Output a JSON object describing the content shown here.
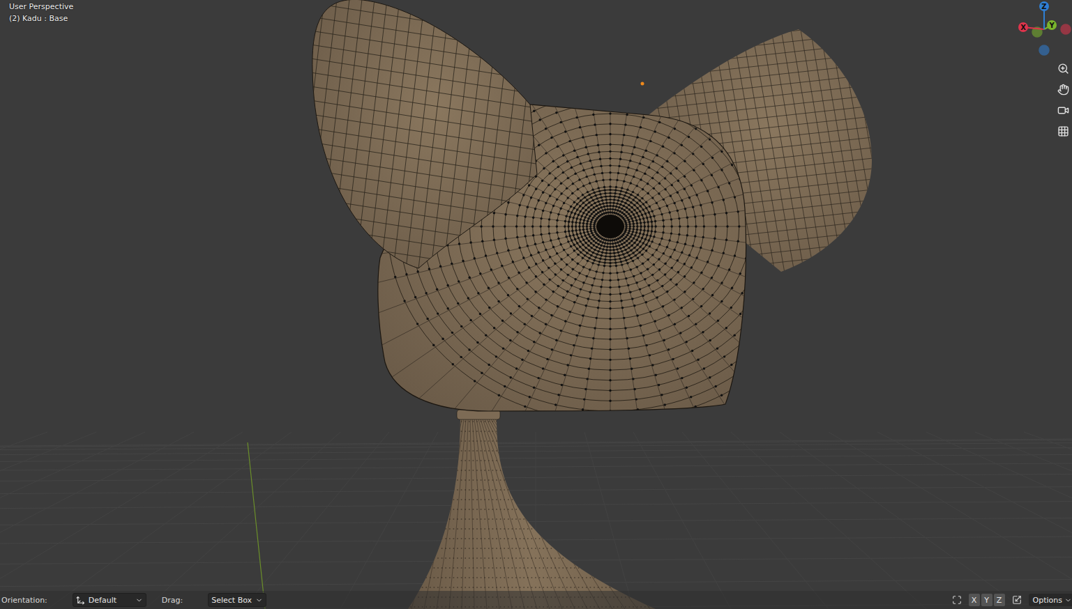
{
  "viewport": {
    "view_name": "User Perspective",
    "object_info": "(2) Kadu : Base"
  },
  "gizmo": {
    "axes": [
      {
        "label": "X",
        "color": "#e0344c"
      },
      {
        "label": "Y",
        "color": "#7bb52c"
      },
      {
        "label": "Z",
        "color": "#2f7fd4"
      }
    ]
  },
  "status_bar": {
    "orientation": {
      "label": "Orientation:",
      "value": "Default"
    },
    "drag": {
      "label": "Drag:",
      "value": "Select Box"
    },
    "mirror_axes": [
      {
        "label": "X",
        "selected": false
      },
      {
        "label": "Y",
        "selected": false
      },
      {
        "label": "Z",
        "selected": false
      }
    ],
    "options": "Options"
  }
}
